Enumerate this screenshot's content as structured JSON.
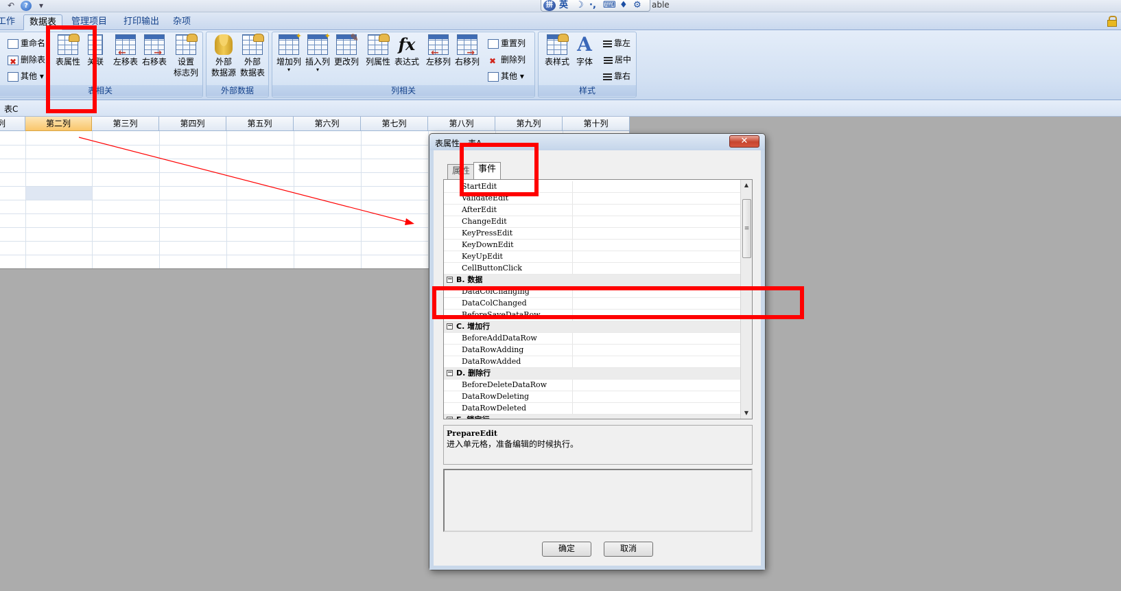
{
  "titlebar": {
    "quick_access": [
      "↶",
      "?",
      "▾"
    ],
    "ime": {
      "logo": "拼",
      "lang": "英",
      "icons": [
        "☽",
        "·,",
        "⌨",
        "♦",
        "⚙"
      ]
    },
    "title_fragment": "able"
  },
  "tabs": [
    {
      "label": "工作",
      "active": false
    },
    {
      "label": "数据表",
      "active": true
    },
    {
      "label": "管理项目",
      "active": false
    },
    {
      "label": "打印输出",
      "active": false
    },
    {
      "label": "杂项",
      "active": false
    }
  ],
  "ribbon": {
    "table_group": {
      "label": "表相关",
      "small": [
        "重命名",
        "删除表",
        "其他"
      ],
      "big": [
        "表属性",
        "关联",
        "左移表",
        "右移表"
      ],
      "set_flag": [
        "设置",
        "标志列"
      ]
    },
    "external_group": {
      "label": "外部数据",
      "btn1": [
        "外部",
        "数据源"
      ],
      "btn2": [
        "外部",
        "数据表"
      ]
    },
    "column_group": {
      "label": "列相关",
      "big": [
        "增加列",
        "插入列",
        "更改列",
        "列属性",
        "表达式",
        "左移列",
        "右移列"
      ],
      "small": [
        "重置列",
        "删除列",
        "其他"
      ]
    },
    "style_group": {
      "label": "样式",
      "big": [
        "表样式",
        "字体"
      ],
      "small": [
        "靠左",
        "居中",
        "靠右"
      ]
    }
  },
  "namebar": {
    "label": "表C"
  },
  "grid": {
    "columns": [
      "列",
      "第二列",
      "第三列",
      "第四列",
      "第五列",
      "第六列",
      "第七列",
      "第八列",
      "第九列",
      "第十列"
    ],
    "selected_column": "第二列"
  },
  "dialog": {
    "title": "表属性 - 表A",
    "close": "✕",
    "tabs": [
      "属性",
      "事件"
    ],
    "active_tab": "事件",
    "events": [
      {
        "type": "item",
        "key": "StartEdit"
      },
      {
        "type": "item",
        "key": "ValidateEdit"
      },
      {
        "type": "item",
        "key": "AfterEdit"
      },
      {
        "type": "item",
        "key": "ChangeEdit"
      },
      {
        "type": "item",
        "key": "KeyPressEdit"
      },
      {
        "type": "item",
        "key": "KeyDownEdit"
      },
      {
        "type": "item",
        "key": "KeyUpEdit"
      },
      {
        "type": "item",
        "key": "CellButtonClick"
      },
      {
        "type": "cat",
        "key": "B. 数据"
      },
      {
        "type": "item",
        "key": "DataColChanging"
      },
      {
        "type": "item",
        "key": "DataColChanged"
      },
      {
        "type": "item",
        "key": "BeforeSaveDataRow"
      },
      {
        "type": "cat",
        "key": "C. 增加行"
      },
      {
        "type": "item",
        "key": "BeforeAddDataRow"
      },
      {
        "type": "item",
        "key": "DataRowAdding"
      },
      {
        "type": "item",
        "key": "DataRowAdded"
      },
      {
        "type": "cat",
        "key": "D. 删除行"
      },
      {
        "type": "item",
        "key": "BeforeDeleteDataRow"
      },
      {
        "type": "item",
        "key": "DataRowDeleting"
      },
      {
        "type": "item",
        "key": "DataRowDeleted"
      },
      {
        "type": "cat",
        "key": "E. 锁定行"
      }
    ],
    "description": {
      "title": "PrepareEdit",
      "text": "进入单元格，准备编辑的时候执行。"
    },
    "ok": "确定",
    "cancel": "取消"
  },
  "colors": {
    "annotation_red": "#ff0000",
    "ribbon_text": "#15428b"
  }
}
